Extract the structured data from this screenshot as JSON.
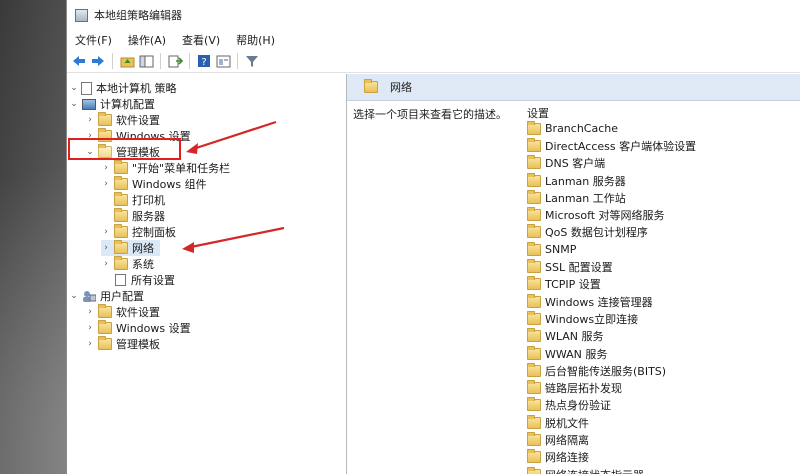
{
  "window": {
    "title": "本地组策略编辑器"
  },
  "menu": [
    "文件(F)",
    "操作(A)",
    "查看(V)",
    "帮助(H)"
  ],
  "tree": {
    "root": "本地计算机 策略",
    "computer_config": "计算机配置",
    "software_settings": "软件设置",
    "windows_settings": "Windows 设置",
    "admin_templates": "管理模板",
    "start_menu": "\"开始\"菜单和任务栏",
    "windows_components": "Windows 组件",
    "printers": "打印机",
    "server": "服务器",
    "control_panel": "控制面板",
    "network": "网络",
    "system": "系统",
    "all_settings": "所有设置",
    "user_config": "用户配置",
    "user_software_settings": "软件设置",
    "user_windows_settings": "Windows 设置",
    "user_admin_templates": "管理模板"
  },
  "right": {
    "header": "网络",
    "description": "选择一个项目来查看它的描述。",
    "column": "设置",
    "items": [
      "BranchCache",
      "DirectAccess 客户端体验设置",
      "DNS 客户端",
      "Lanman 服务器",
      "Lanman 工作站",
      "Microsoft 对等网络服务",
      "QoS 数据包计划程序",
      "SNMP",
      "SSL 配置设置",
      "TCPIP 设置",
      "Windows 连接管理器",
      "Windows立即连接",
      "WLAN 服务",
      "WWAN 服务",
      "后台智能传送服务(BITS)",
      "链路层拓扑发现",
      "热点身份验证",
      "脱机文件",
      "网络隔离",
      "网络连接",
      "网络连接状态指示器"
    ]
  },
  "colors": {
    "highlight_box": "#e02020",
    "arrow": "#d42828",
    "header_bg": "#dfe9f6",
    "folder": "#e8c15a"
  }
}
